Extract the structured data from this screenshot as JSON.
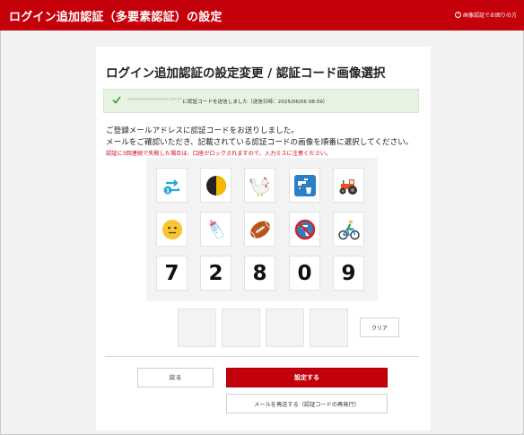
{
  "header": {
    "title": "ログイン追加認証（多要素認証）の設定",
    "help_label": "画像認証でお困りの方",
    "help_icon": "question-circle-icon"
  },
  "page": {
    "title": "ログイン追加認証の設定変更 / 認証コード画像選択"
  },
  "notice": {
    "icon": "check-icon",
    "masked_email": "******************.***.**",
    "sent_text": "に認証コードを送信しました（送信日時：2025/06/06 08:59）"
  },
  "instructions": {
    "line1": "ご登録メールアドレスに認証コードをお送りしました。",
    "line2": "メールをご確認いただき、記載されている認証コードの画像を順番に選択してください。",
    "warning": "認証に3回連続で失敗した場合は、口座がロックされますので、入力ミスに注意ください。"
  },
  "image_choices": {
    "row1": [
      {
        "icon": "repeat-one-icon",
        "label": ""
      },
      {
        "icon": "half-moon-icon",
        "label": ""
      },
      {
        "icon": "rooster-icon",
        "label": ""
      },
      {
        "icon": "water-faucet-icon",
        "label": ""
      },
      {
        "icon": "tractor-icon",
        "label": ""
      }
    ],
    "row2": [
      {
        "icon": "smiley-face-icon",
        "label": ""
      },
      {
        "icon": "baby-bottle-icon",
        "label": ""
      },
      {
        "icon": "football-icon",
        "label": ""
      },
      {
        "icon": "no-drinking-water-icon",
        "label": ""
      },
      {
        "icon": "cyclist-icon",
        "label": ""
      }
    ],
    "row3": [
      {
        "digit": "7"
      },
      {
        "digit": "2"
      },
      {
        "digit": "8"
      },
      {
        "digit": "0"
      },
      {
        "digit": "9"
      }
    ]
  },
  "actions": {
    "clear_label": "クリア",
    "back_label": "戻る",
    "submit_label": "設定する",
    "resend_label": "メールを再送する（認証コードの再発行）"
  },
  "colors": {
    "brand_red": "#c4000b",
    "notice_green_bg": "#e6f3e2",
    "check_green": "#3a9a3a"
  }
}
